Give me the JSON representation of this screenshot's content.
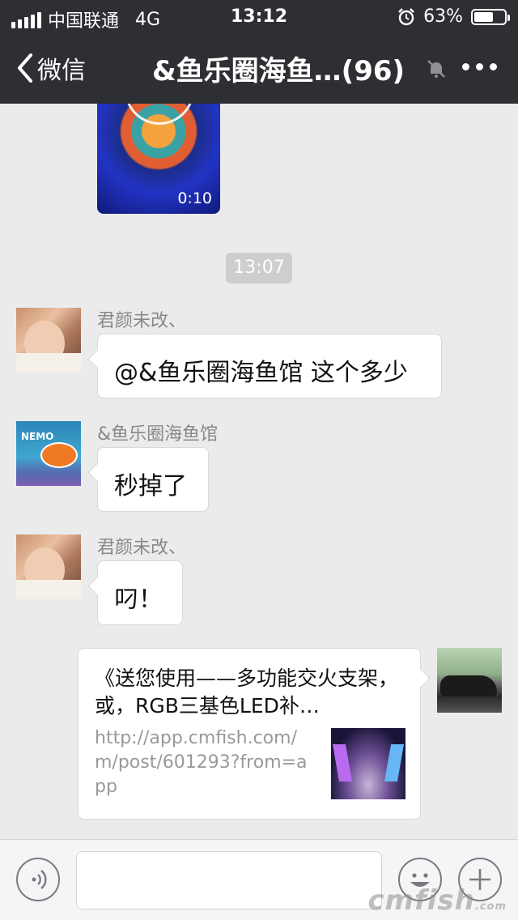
{
  "status": {
    "carrier": "中国联通",
    "network": "4G",
    "time": "13:12",
    "battery": "63%",
    "battery_level": 0.63
  },
  "nav": {
    "back_label": "微信",
    "title": "&鱼乐圈海鱼…(96)"
  },
  "messages": {
    "video_duration": "0:10",
    "timestamp": "13:07",
    "m1": {
      "sender": "君颜未改、",
      "text": "@&鱼乐圈海鱼馆 这个多少"
    },
    "m2": {
      "sender": "&鱼乐圈海鱼馆",
      "text": "秒掉了"
    },
    "m3": {
      "sender": "君颜未改、",
      "text": "叼！"
    },
    "link": {
      "title": "《送您使用——多功能交火支架，或，RGB三基色LED补…",
      "url": "http://app.cmfish.com/m/post/601293?from=app"
    }
  },
  "watermark": {
    "main": "cmfish",
    "sub": ".com"
  },
  "colors": {
    "nav_bg": "#2e2f33",
    "chat_bg": "#ebebeb",
    "bubble": "#ffffff"
  }
}
